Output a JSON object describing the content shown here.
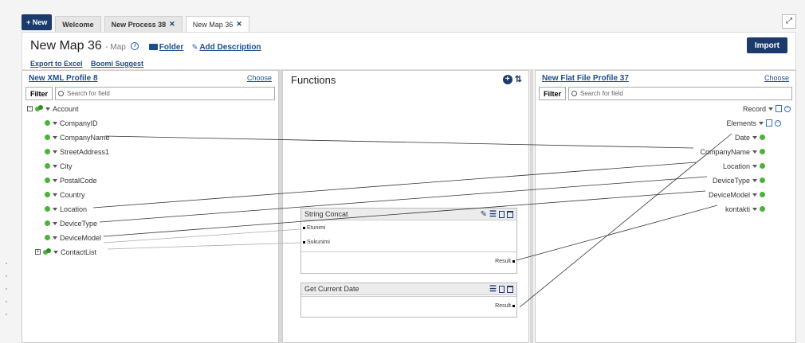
{
  "tabs": {
    "new_label": "+ New",
    "items": [
      {
        "label": "Welcome",
        "closable": false
      },
      {
        "label": "New Process 38",
        "closable": true
      },
      {
        "label": "New Map 36",
        "closable": true
      }
    ],
    "close_glyph": "✕"
  },
  "header": {
    "title": "New Map 36",
    "subtitle": "- Map",
    "folder_label": "Folder",
    "description_label": "Add Description",
    "export_label": "Export to Excel",
    "suggest_label": "Boomi Suggest",
    "import_label": "Import"
  },
  "left": {
    "title": "New XML Profile 8",
    "choose_label": "Choose",
    "filter_label": "Filter",
    "search_placeholder": "Search for field",
    "root": "Account",
    "fields": [
      "CompanyID",
      "CompanyName",
      "StreetAddress1",
      "City",
      "PostalCode",
      "Country",
      "Location",
      "DeviceType",
      "DeviceModel"
    ],
    "collapsed": "ContactList"
  },
  "functions": {
    "title": "Functions",
    "boxes": [
      {
        "name": "String Concat",
        "inputs": [
          "Etunimi",
          "Sukunimi"
        ],
        "output": "Result"
      },
      {
        "name": "Get Current Date",
        "inputs": [],
        "output": "Result"
      }
    ]
  },
  "right": {
    "title": "New Flat File Profile 37",
    "choose_label": "Choose",
    "filter_label": "Filter",
    "search_placeholder": "Search for field",
    "record": "Record",
    "elements": "Elements",
    "fields": [
      "Date",
      "CompanyName",
      "Location",
      "DeviceType",
      "DeviceModel",
      "kontakti"
    ]
  },
  "colors": {
    "navy": "#1c3a6b",
    "link": "#1c4d8c",
    "bullet": "#4bb33a"
  }
}
